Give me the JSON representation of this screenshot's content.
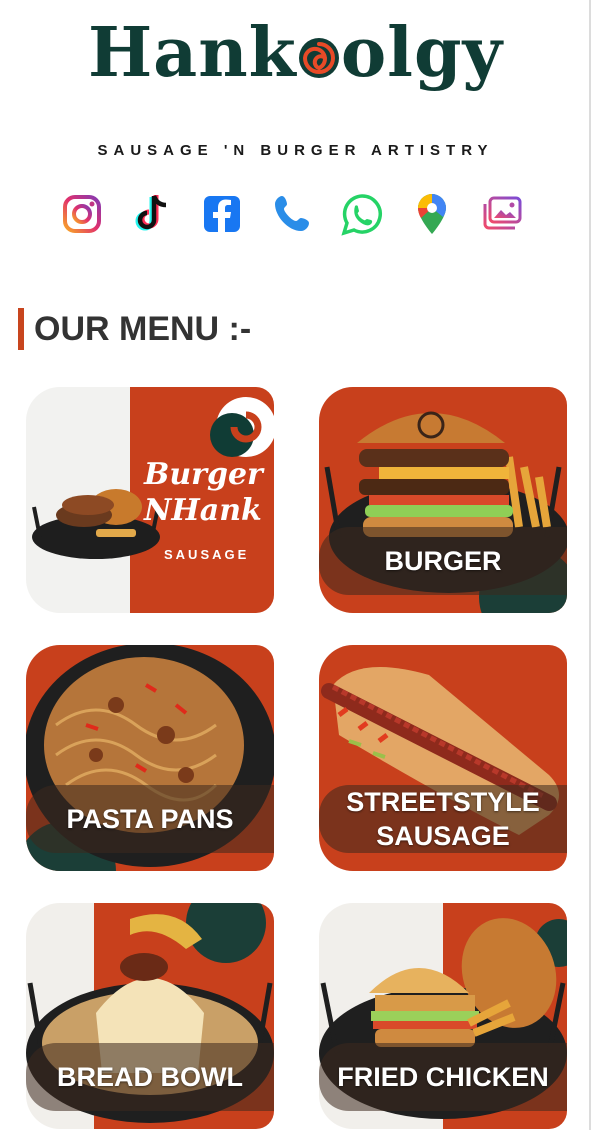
{
  "brand": {
    "logo_text_a": "Hank",
    "logo_text_b": "olgy",
    "tagline": "SAUSAGE 'N BURGER ARTISTRY",
    "primary_color": "#103c35",
    "accent_color": "#c8451e"
  },
  "social": [
    {
      "icon": "instagram-icon"
    },
    {
      "icon": "tiktok-icon"
    },
    {
      "icon": "facebook-icon"
    },
    {
      "icon": "phone-icon"
    },
    {
      "icon": "whatsapp-icon"
    },
    {
      "icon": "map-pin-icon"
    },
    {
      "icon": "gallery-icon"
    }
  ],
  "menu": {
    "heading": "OUR MENU :-",
    "feature_card": {
      "title": "Burger\nNHank",
      "subtitle": "SAUSAGE"
    },
    "items": [
      {
        "label": "BURGER"
      },
      {
        "label": "PASTA PANS"
      },
      {
        "label": "STREETSTYLE\nSAUSAGE"
      },
      {
        "label": "BREAD BOWL"
      },
      {
        "label": "FRIED CHICKEN"
      }
    ]
  }
}
